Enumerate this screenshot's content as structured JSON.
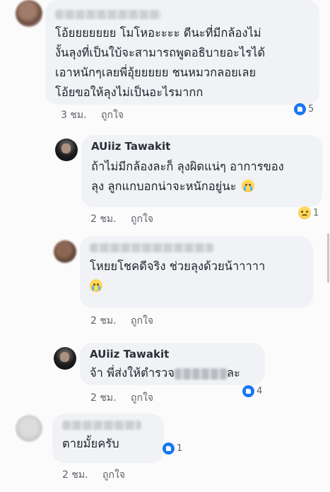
{
  "comments": [
    {
      "author_visible": false,
      "text": "โอ้ยยยยยยย โมโหอะะะะ ดีนะที่มีกล้องไม่\nงั้นลุงที่เป็นใบ้จะสามารถพูดอธิบายอะไรได้\nเอาหนักๆเลยพี่อุ้ยยยยย ชนหมวกลอยเลย\nโอ้ยขอให้ลุงไม่เป็นอะไรมากก",
      "time": "3 ชม.",
      "like_label": "ถูกใจ",
      "reaction": "like",
      "reaction_count": "5"
    },
    {
      "author": "AUiiz Tawakit",
      "text": "ถ้าไม่มีกล้องละก็ ลุงผิดแน่ๆ อาการของ\nลุง ลูกแกบอกน่าจะหนักอยู่นะ",
      "emoji": "crying-face",
      "time": "2 ชม.",
      "like_label": "ถูกใจ",
      "reaction": "sad",
      "reaction_count": "1"
    },
    {
      "author_visible": false,
      "text_line1": "โหยยโชคดีจริง ช่วยลุงด้วยน้าาาาา",
      "emoji": "crying-face",
      "time": "2 ชม.",
      "like_label": "ถูกใจ"
    },
    {
      "author": "AUiiz Tawakit",
      "text_before": "จ้า พี่ส่งให้ตำรวจ",
      "text_after": "ละ",
      "time": "2 ชม.",
      "like_label": "ถูกใจ",
      "reaction": "like",
      "reaction_count": "4"
    },
    {
      "author_visible": false,
      "text": "ตายมั้ยครับ",
      "time": "2 ชม.",
      "like_label": "ถูกใจ",
      "reaction": "like",
      "reaction_count": "1"
    }
  ]
}
